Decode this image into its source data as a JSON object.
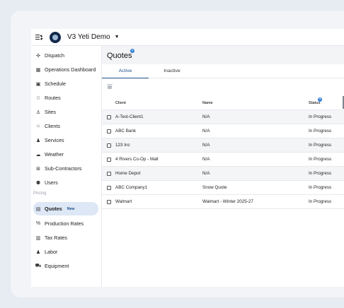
{
  "header": {
    "org_name": "V3 Yeti Demo"
  },
  "sidebar": {
    "items": [
      {
        "label": "Dispatch",
        "icon": "dispatch-icon"
      },
      {
        "label": "Operations Dashboard",
        "icon": "dashboard-icon"
      },
      {
        "label": "Schedule",
        "icon": "calendar-icon"
      },
      {
        "label": "Routes",
        "icon": "routes-icon"
      },
      {
        "label": "Sites",
        "icon": "sites-icon"
      },
      {
        "label": "Clients",
        "icon": "clients-icon"
      },
      {
        "label": "Services",
        "icon": "services-icon"
      },
      {
        "label": "Weather",
        "icon": "cloud-icon"
      },
      {
        "label": "Sub-Contractors",
        "icon": "subcontractors-icon"
      },
      {
        "label": "Users",
        "icon": "users-icon"
      }
    ],
    "section_label": "Pricing",
    "pricing_items": [
      {
        "label": "Quotes",
        "icon": "quotes-icon",
        "badge": "New",
        "active": true
      },
      {
        "label": "Production Rates",
        "icon": "percent-icon"
      },
      {
        "label": "Tax Rates",
        "icon": "tax-icon"
      },
      {
        "label": "Labor",
        "icon": "labor-icon"
      },
      {
        "label": "Equipment",
        "icon": "truck-icon"
      }
    ]
  },
  "main": {
    "title": "Quotes",
    "help": "?",
    "tabs": [
      {
        "label": "Active",
        "active": true
      },
      {
        "label": "Inactive",
        "active": false
      }
    ],
    "table": {
      "columns": [
        "Client",
        "Name",
        "Status"
      ],
      "rows": [
        {
          "client": "A-Test-Client1",
          "name": "N/A",
          "status": "In Progress"
        },
        {
          "client": "ABC Bank",
          "name": "N/A",
          "status": "In Progress"
        },
        {
          "client": "123 Inc",
          "name": "N/A",
          "status": "In Progress"
        },
        {
          "client": "4 Rivers Co-Op - Mall",
          "name": "N/A",
          "status": "In Progress"
        },
        {
          "client": "Home Depot",
          "name": "N/A",
          "status": "In Progress"
        },
        {
          "client": "ABC Company1",
          "name": "Snow Quote",
          "status": "In Progress"
        },
        {
          "client": "Walmart",
          "name": "Walmart - Winter 2025-27",
          "status": "In Progress"
        }
      ]
    }
  },
  "colors": {
    "accent": "#1f4e8c",
    "help_badge": "#2f7bd6",
    "active_nav_bg": "#dde7f5",
    "logo_bg": "#12284a"
  }
}
